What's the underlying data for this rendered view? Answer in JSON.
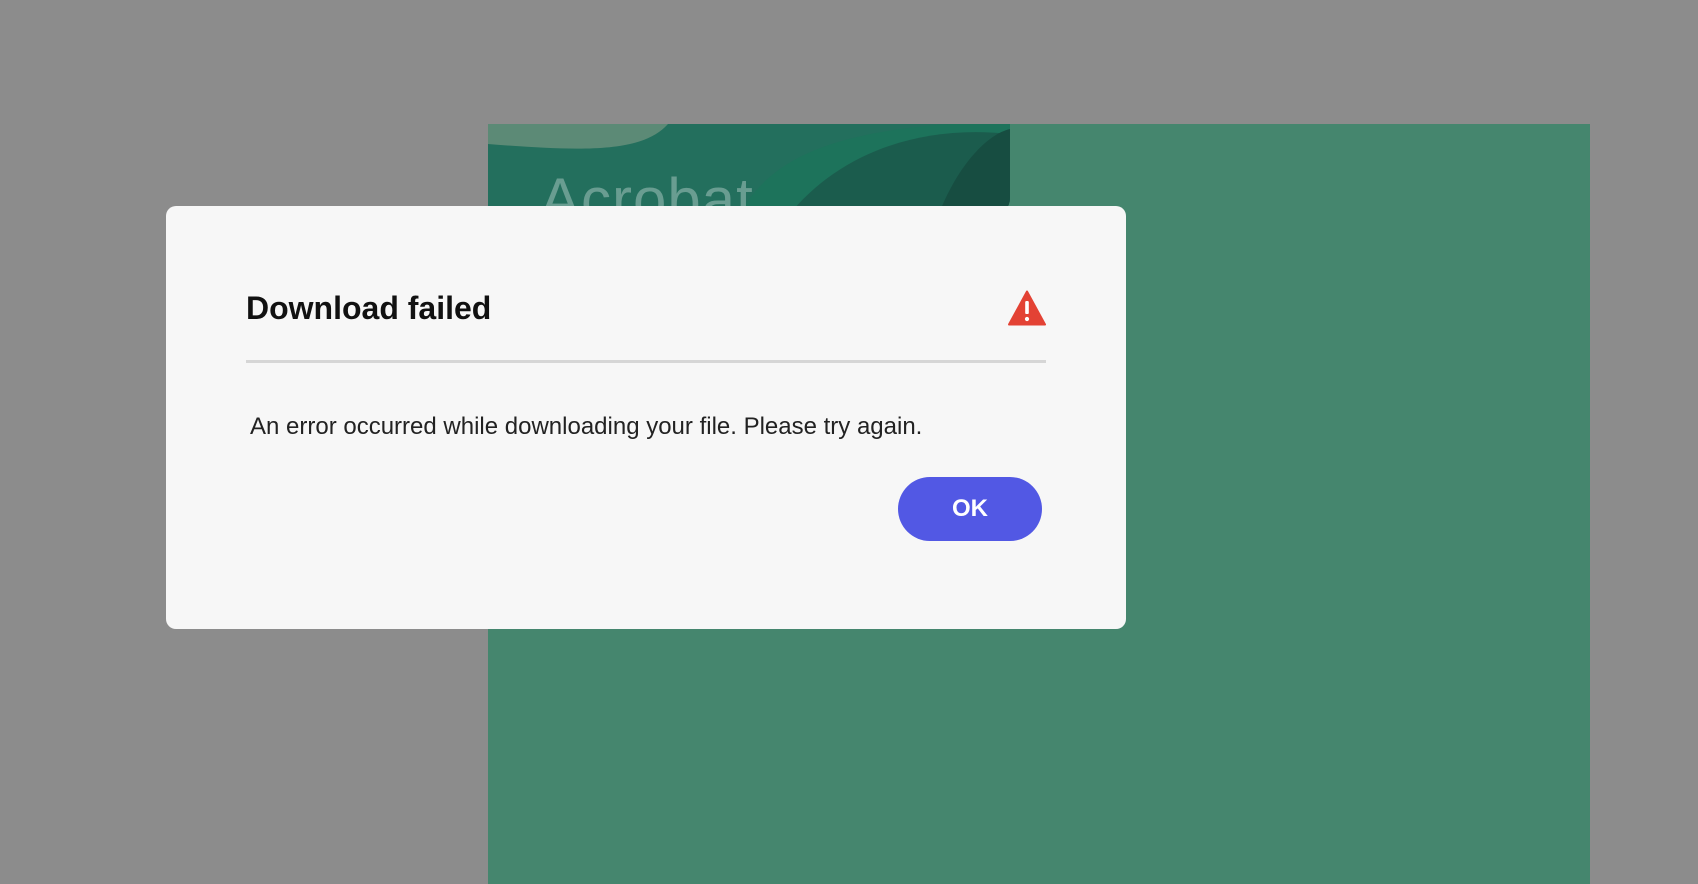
{
  "colors": {
    "backdrop": "#8c8c8c",
    "panel": "#45866e",
    "dialog_background": "#f7f7f7",
    "primary_button": "#5258e4",
    "warning": "#e34234"
  },
  "background": {
    "heading": "Acrobat"
  },
  "dialog": {
    "title": "Download failed",
    "icon": "warning-icon",
    "message": "An error occurred while downloading your file. Please try again.",
    "ok_label": "OK"
  }
}
